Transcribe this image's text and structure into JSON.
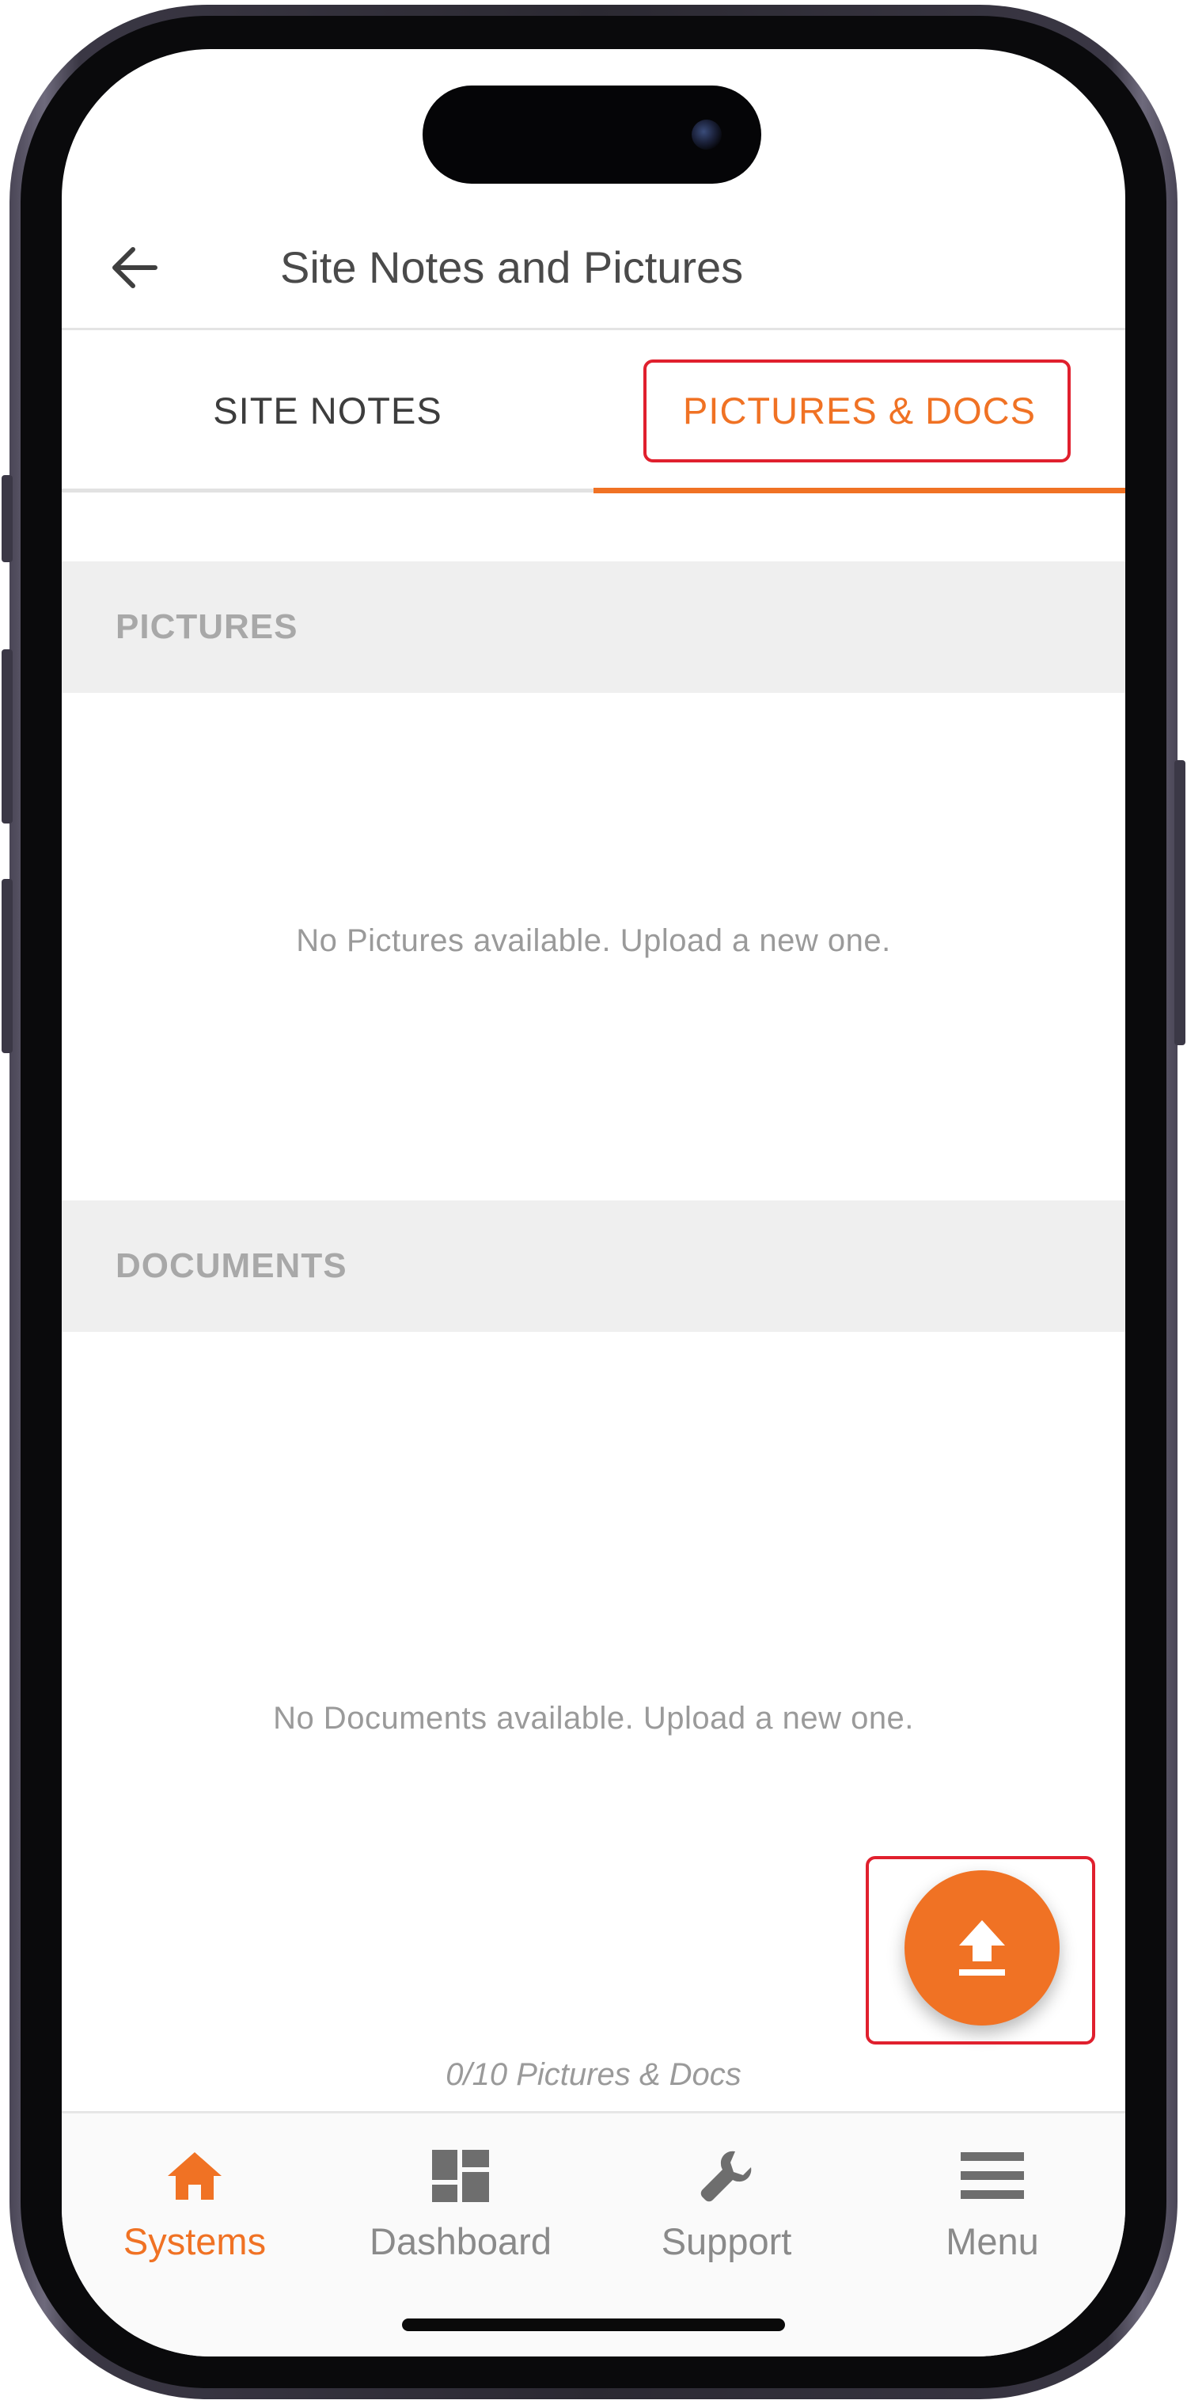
{
  "header": {
    "title": "Site Notes and Pictures",
    "back_icon": "arrow-left-icon"
  },
  "tabs": [
    {
      "label": "SITE NOTES",
      "active": false
    },
    {
      "label": "PICTURES & DOCS",
      "active": true
    }
  ],
  "sections": {
    "pictures": {
      "label": "PICTURES",
      "empty_message": "No Pictures available. Upload a new one."
    },
    "documents": {
      "label": "DOCUMENTS",
      "empty_message": "No Documents available. Upload a new one."
    }
  },
  "upload_button": {
    "icon": "upload-icon"
  },
  "counter": "0/10 Pictures & Docs",
  "bottom_nav": [
    {
      "label": "Systems",
      "icon": "home-icon",
      "active": true
    },
    {
      "label": "Dashboard",
      "icon": "dashboard-icon",
      "active": false
    },
    {
      "label": "Support",
      "icon": "wrench-icon",
      "active": false
    },
    {
      "label": "Menu",
      "icon": "hamburger-menu-icon",
      "active": false
    }
  ],
  "colors": {
    "accent": "#f07224",
    "highlight_box": "#e0202e",
    "section_bg": "#efefef",
    "muted_text": "#9a9a9a"
  }
}
